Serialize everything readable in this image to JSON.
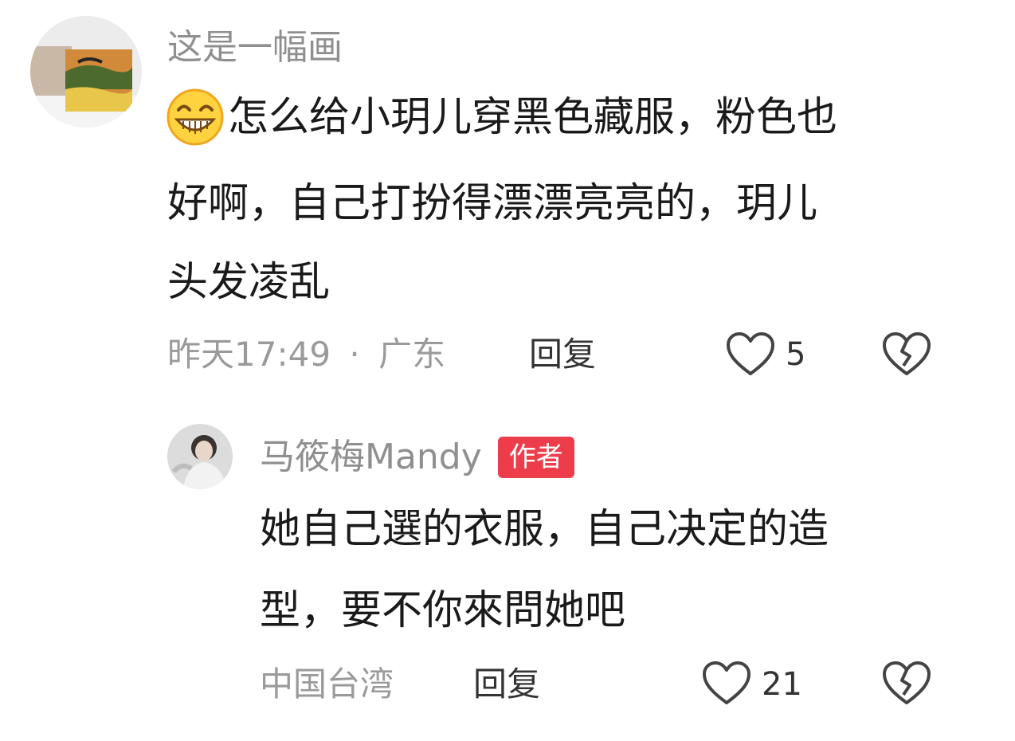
{
  "comment": {
    "username": "这是一幅画",
    "emoji": "grinning-face-icon",
    "text_line1": "怎么给小玥儿穿黑色藏服，粉色也",
    "text_line2": "好啊，自己打扮得漂漂亮亮的，玥儿",
    "text_line3": "头发凌乱",
    "time": "昨天17:49",
    "separator": "·",
    "location": "广东",
    "reply_label": "回复",
    "like_count": "5"
  },
  "reply": {
    "username": "马筱梅Mandy",
    "author_badge": "作者",
    "text_line1": "她自己選的衣服，自己决定的造",
    "text_line2": "型，要不你來問她吧",
    "location": "中国台湾",
    "reply_label": "回复",
    "like_count": "21"
  },
  "colors": {
    "badge": "#ee3d4a",
    "meta_text": "#9a9a9a",
    "icon_stroke": "#444444"
  }
}
